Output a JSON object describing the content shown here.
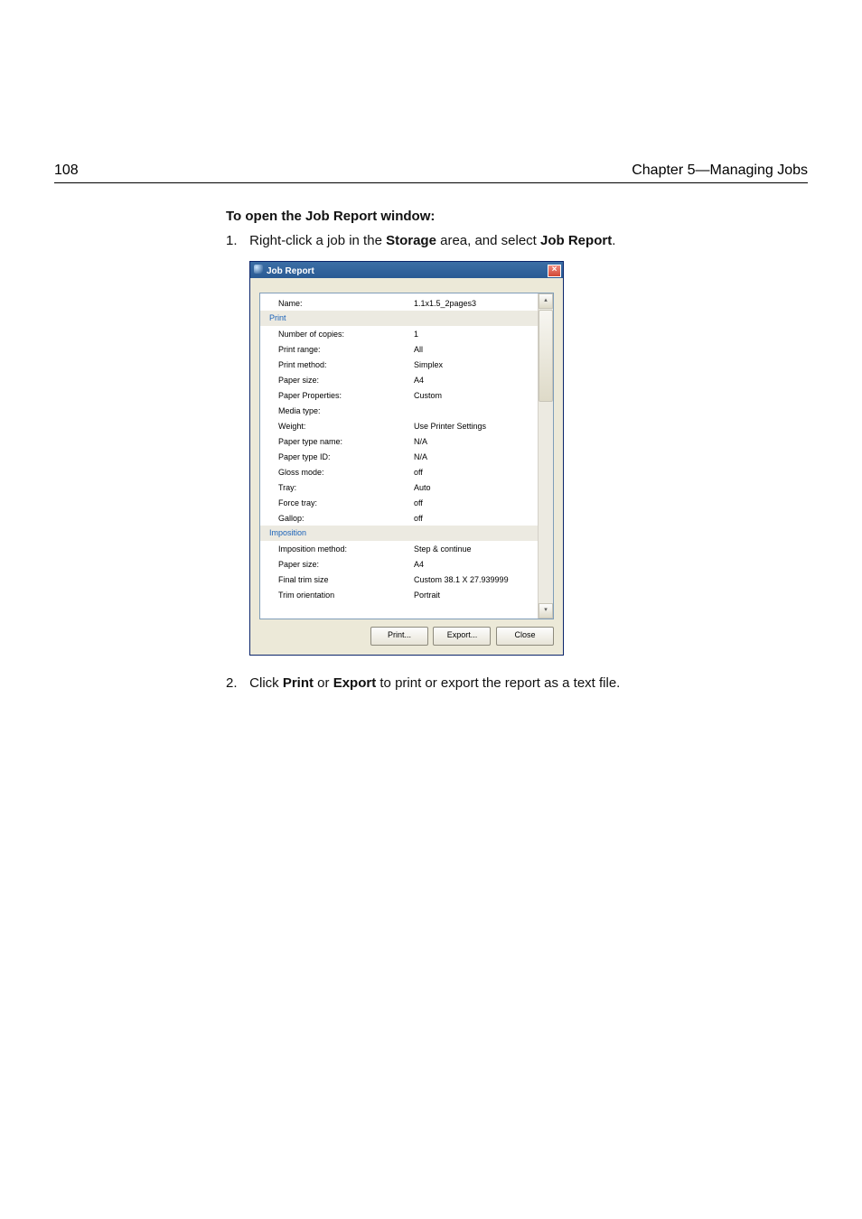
{
  "header": {
    "page_number": "108",
    "chapter": "Chapter 5—Managing Jobs"
  },
  "body": {
    "section_title": "To open the Job Report window:",
    "step1": {
      "num": "1.",
      "t1": "Right-click a job in the ",
      "b1": "Storage",
      "t2": " area, and select ",
      "b2": "Job Report",
      "t3": "."
    },
    "step2": {
      "num": "2.",
      "t1": "Click ",
      "b1": "Print",
      "t2": " or ",
      "b2": "Export",
      "t3": " to print or export the report as a text file."
    }
  },
  "dialog": {
    "title": "Job Report",
    "close_glyph": "×",
    "scroll_up": "▴",
    "scroll_down": "▾",
    "name": {
      "lbl": "Name:",
      "val": "1.1x1.5_2pages3"
    },
    "section_print": "Print",
    "rows_print": [
      {
        "lbl": "Number of copies:",
        "val": "1"
      },
      {
        "lbl": "Print range:",
        "val": "All"
      },
      {
        "lbl": "Print method:",
        "val": "Simplex"
      },
      {
        "lbl": "Paper size:",
        "val": "A4"
      },
      {
        "lbl": "Paper Properties:",
        "val": "Custom"
      },
      {
        "lbl": "Media type:",
        "val": ""
      },
      {
        "lbl": "Weight:",
        "val": "Use Printer Settings"
      },
      {
        "lbl": "Paper type name:",
        "val": "N/A"
      },
      {
        "lbl": "Paper type ID:",
        "val": "N/A"
      },
      {
        "lbl": "Gloss mode:",
        "val": "off"
      },
      {
        "lbl": "Tray:",
        "val": "Auto"
      },
      {
        "lbl": "Force tray:",
        "val": "off"
      },
      {
        "lbl": "Gallop:",
        "val": "off"
      }
    ],
    "section_impo": "Imposition",
    "rows_impo": [
      {
        "lbl": "Imposition method:",
        "val": "Step & continue"
      },
      {
        "lbl": "Paper size:",
        "val": "A4"
      },
      {
        "lbl": "Final trim size",
        "val": "Custom 38.1 X 27.939999"
      },
      {
        "lbl": "Trim orientation",
        "val": "Portrait"
      }
    ],
    "buttons": {
      "print": "Print...",
      "export": "Export...",
      "close": "Close"
    }
  }
}
